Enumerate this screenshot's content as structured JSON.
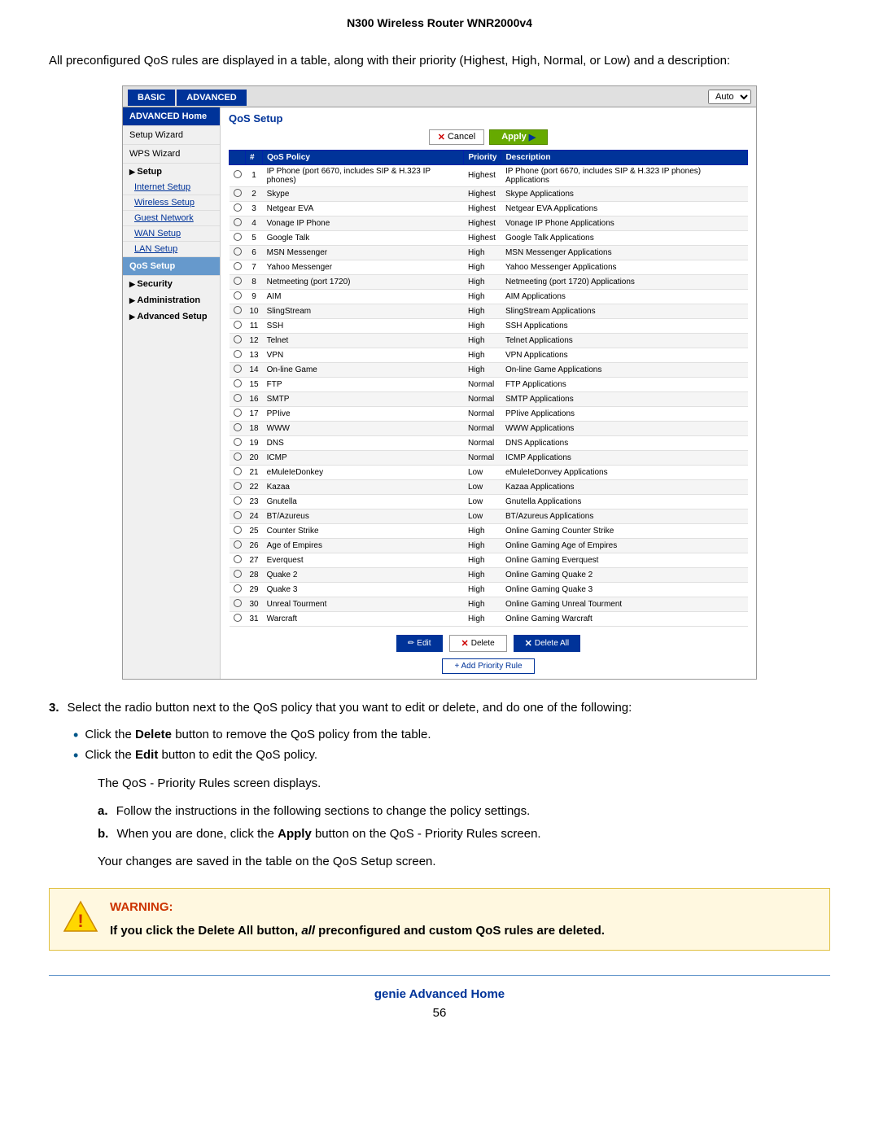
{
  "header": {
    "title": "N300 Wireless Router WNR2000v4"
  },
  "intro": {
    "text": "All preconfigured QoS rules are displayed in a table, along with their priority (Highest, High, Normal, or Low) and a description:"
  },
  "router": {
    "tab_basic": "BASIC",
    "tab_advanced": "ADVANCED",
    "auto_label": "Auto",
    "sidebar": {
      "advanced_home": "ADVANCED Home",
      "setup_wizard": "Setup Wizard",
      "wps_wizard": "WPS Wizard",
      "setup_section": "Setup",
      "internet_setup": "Internet Setup",
      "wireless_setup": "Wireless Setup",
      "guest_network": "Guest Network",
      "wan_setup": "WAN Setup",
      "lan_setup": "LAN Setup",
      "qos_setup": "QoS Setup",
      "security_section": "Security",
      "administration_section": "Administration",
      "advanced_setup_section": "Advanced Setup"
    },
    "main": {
      "title": "QoS Setup",
      "cancel_label": "Cancel",
      "apply_label": "Apply",
      "table_headers": [
        "#",
        "QoS Policy",
        "Priority",
        "Description"
      ],
      "rows": [
        {
          "num": 1,
          "policy": "IP Phone (port 6670, includes SIP & H.323 IP phones)",
          "priority": "Highest",
          "description": "IP Phone (port 6670, includes SIP & H.323 IP phones) Applications"
        },
        {
          "num": 2,
          "policy": "Skype",
          "priority": "Highest",
          "description": "Skype Applications"
        },
        {
          "num": 3,
          "policy": "Netgear EVA",
          "priority": "Highest",
          "description": "Netgear EVA Applications"
        },
        {
          "num": 4,
          "policy": "Vonage IP Phone",
          "priority": "Highest",
          "description": "Vonage IP Phone Applications"
        },
        {
          "num": 5,
          "policy": "Google Talk",
          "priority": "Highest",
          "description": "Google Talk Applications"
        },
        {
          "num": 6,
          "policy": "MSN Messenger",
          "priority": "High",
          "description": "MSN Messenger Applications"
        },
        {
          "num": 7,
          "policy": "Yahoo Messenger",
          "priority": "High",
          "description": "Yahoo Messenger Applications"
        },
        {
          "num": 8,
          "policy": "Netmeeting (port 1720)",
          "priority": "High",
          "description": "Netmeeting (port 1720) Applications"
        },
        {
          "num": 9,
          "policy": "AIM",
          "priority": "High",
          "description": "AIM Applications"
        },
        {
          "num": 10,
          "policy": "SlingStream",
          "priority": "High",
          "description": "SlingStream Applications"
        },
        {
          "num": 11,
          "policy": "SSH",
          "priority": "High",
          "description": "SSH Applications"
        },
        {
          "num": 12,
          "policy": "Telnet",
          "priority": "High",
          "description": "Telnet Applications"
        },
        {
          "num": 13,
          "policy": "VPN",
          "priority": "High",
          "description": "VPN Applications"
        },
        {
          "num": 14,
          "policy": "On-line Game",
          "priority": "High",
          "description": "On-line Game Applications"
        },
        {
          "num": 15,
          "policy": "FTP",
          "priority": "Normal",
          "description": "FTP Applications"
        },
        {
          "num": 16,
          "policy": "SMTP",
          "priority": "Normal",
          "description": "SMTP Applications"
        },
        {
          "num": 17,
          "policy": "PPIive",
          "priority": "Normal",
          "description": "PPIive Applications"
        },
        {
          "num": 18,
          "policy": "WWW",
          "priority": "Normal",
          "description": "WWW Applications"
        },
        {
          "num": 19,
          "policy": "DNS",
          "priority": "Normal",
          "description": "DNS Applications"
        },
        {
          "num": 20,
          "policy": "ICMP",
          "priority": "Normal",
          "description": "ICMP Applications"
        },
        {
          "num": 21,
          "policy": "eMuleIeDonkey",
          "priority": "Low",
          "description": "eMuleIeDonvey Applications"
        },
        {
          "num": 22,
          "policy": "Kazaa",
          "priority": "Low",
          "description": "Kazaa Applications"
        },
        {
          "num": 23,
          "policy": "Gnutella",
          "priority": "Low",
          "description": "Gnutella Applications"
        },
        {
          "num": 24,
          "policy": "BT/Azureus",
          "priority": "Low",
          "description": "BT/Azureus Applications"
        },
        {
          "num": 25,
          "policy": "Counter Strike",
          "priority": "High",
          "description": "Online Gaming Counter Strike"
        },
        {
          "num": 26,
          "policy": "Age of Empires",
          "priority": "High",
          "description": "Online Gaming Age of Empires"
        },
        {
          "num": 27,
          "policy": "Everquest",
          "priority": "High",
          "description": "Online Gaming Everquest"
        },
        {
          "num": 28,
          "policy": "Quake 2",
          "priority": "High",
          "description": "Online Gaming Quake 2"
        },
        {
          "num": 29,
          "policy": "Quake 3",
          "priority": "High",
          "description": "Online Gaming Quake 3"
        },
        {
          "num": 30,
          "policy": "Unreal Tourment",
          "priority": "High",
          "description": "Online Gaming Unreal Tourment"
        },
        {
          "num": 31,
          "policy": "Warcraft",
          "priority": "High",
          "description": "Online Gaming Warcraft"
        }
      ],
      "edit_label": "Edit",
      "delete_label": "Delete",
      "delete_all_label": "Delete All",
      "add_priority_label": "Add Priority Rule"
    }
  },
  "step3": {
    "number": "3.",
    "text": "Select the radio button next to the QoS policy that you want to edit or delete, and do one of the following:",
    "bullets": [
      {
        "text": "Click the ",
        "bold": "Delete",
        "rest": " button to remove the QoS policy from the table."
      },
      {
        "text": "Click the ",
        "bold": "Edit",
        "rest": " button to edit the QoS policy."
      }
    ],
    "sub_intro": "The QoS - Priority Rules screen displays.",
    "sub_items": [
      {
        "label": "a.",
        "text": "Follow the instructions in the following sections to change the policy settings."
      },
      {
        "label": "b.",
        "text": "When you are done, click the ",
        "bold": "Apply",
        "rest": " button on the QoS - Priority Rules screen."
      }
    ],
    "indent_text": "Your changes are saved in the table on the QoS Setup screen."
  },
  "warning": {
    "title": "WARNING:",
    "body_before": "If you click the Delete All button, ",
    "body_italic": "all",
    "body_after": " preconfigured and custom QoS rules are deleted."
  },
  "footer": {
    "link": "genie Advanced Home",
    "page": "56"
  }
}
